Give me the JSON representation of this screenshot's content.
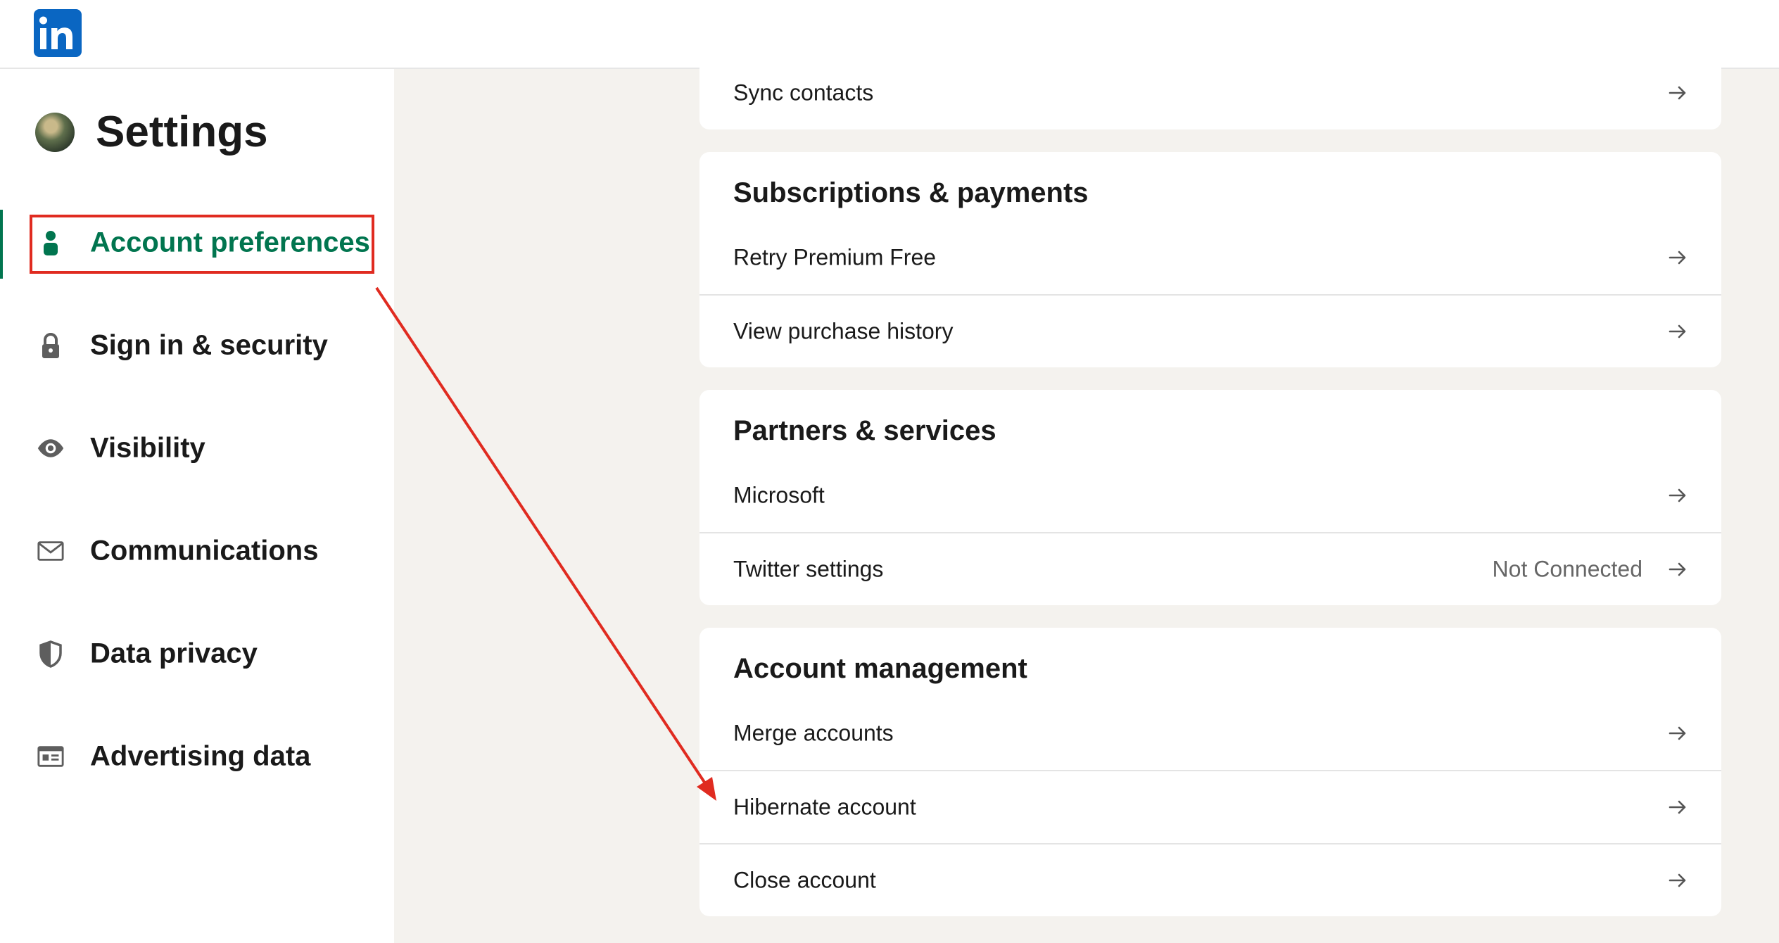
{
  "app": {
    "logo_icon": "linkedin-logo",
    "brand_color": "#0a66c2",
    "accent_color": "#01754f",
    "annotation_color": "#e02b20"
  },
  "sidebar": {
    "title": "Settings",
    "items": [
      {
        "label": "Account preferences",
        "icon": "person-icon",
        "active": true
      },
      {
        "label": "Sign in & security",
        "icon": "lock-icon"
      },
      {
        "label": "Visibility",
        "icon": "eye-icon"
      },
      {
        "label": "Communications",
        "icon": "envelope-icon"
      },
      {
        "label": "Data privacy",
        "icon": "shield-icon"
      },
      {
        "label": "Advertising data",
        "icon": "ad-icon"
      }
    ]
  },
  "main": {
    "sync_card": {
      "rows": [
        {
          "label": "Sync contacts"
        }
      ]
    },
    "subscriptions": {
      "title": "Subscriptions & payments",
      "rows": [
        {
          "label": "Retry Premium Free"
        },
        {
          "label": "View purchase history"
        }
      ]
    },
    "partners": {
      "title": "Partners & services",
      "rows": [
        {
          "label": "Microsoft"
        },
        {
          "label": "Twitter settings",
          "status": "Not Connected"
        }
      ]
    },
    "account_management": {
      "title": "Account management",
      "rows": [
        {
          "label": "Merge accounts"
        },
        {
          "label": "Hibernate account"
        },
        {
          "label": "Close account"
        }
      ]
    }
  }
}
